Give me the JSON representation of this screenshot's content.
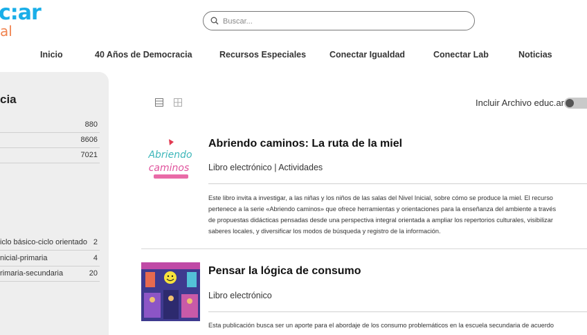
{
  "header": {
    "logo_main": "c:ar",
    "logo_sub": "al",
    "search_placeholder": "Buscar..."
  },
  "nav": [
    {
      "label": "Inicio"
    },
    {
      "label": "40 Años de Democracia"
    },
    {
      "label": "Recursos Especiales"
    },
    {
      "label": "Conectar Igualdad"
    },
    {
      "label": "Conectar Lab"
    },
    {
      "label": "Noticias"
    }
  ],
  "sidebar": {
    "title": "cia",
    "top_rows": [
      {
        "label": "",
        "count": "880"
      },
      {
        "label": "",
        "count": "8606"
      },
      {
        "label": "",
        "count": "7021"
      }
    ],
    "level_rows": [
      {
        "label": "iclo básico-ciclo orientado",
        "count": "2"
      },
      {
        "label": "nicial-primaria",
        "count": "4"
      },
      {
        "label": "rimaria-secundaria",
        "count": "20"
      }
    ]
  },
  "toolbar": {
    "archive_label": "Incluir Archivo educ.ar",
    "archive_enabled": false
  },
  "results": [
    {
      "title": "Abriendo caminos: La ruta de la miel",
      "type": "Libro electrónico | Actividades",
      "image_icon": "abriendo-caminos-cover",
      "desc_lines": [
        "Este libro invita a investigar, a las niñas y los niños de las salas del Nivel Inicial, sobre cómo se produce la miel. El recurso",
        "pertenece a la serie «Abriendo caminos» que ofrece herramientas y orientaciones para la enseñanza del ambiente a través",
        "de propuestas didácticas pensadas desde una perspectiva integral orientada a ampliar los repertorios culturales, visibilizar",
        "saberes locales, y diversificar los modos de búsqueda y registro de la información."
      ]
    },
    {
      "title": "Pensar la lógica de consumo",
      "type": "Libro electrónico",
      "image_icon": "consumo-cover",
      "desc_lines": [
        "Esta publicación busca ser un aporte para el abordaje de los consumo problemáticos en la escuela secundaria de acuerdo"
      ]
    }
  ]
}
